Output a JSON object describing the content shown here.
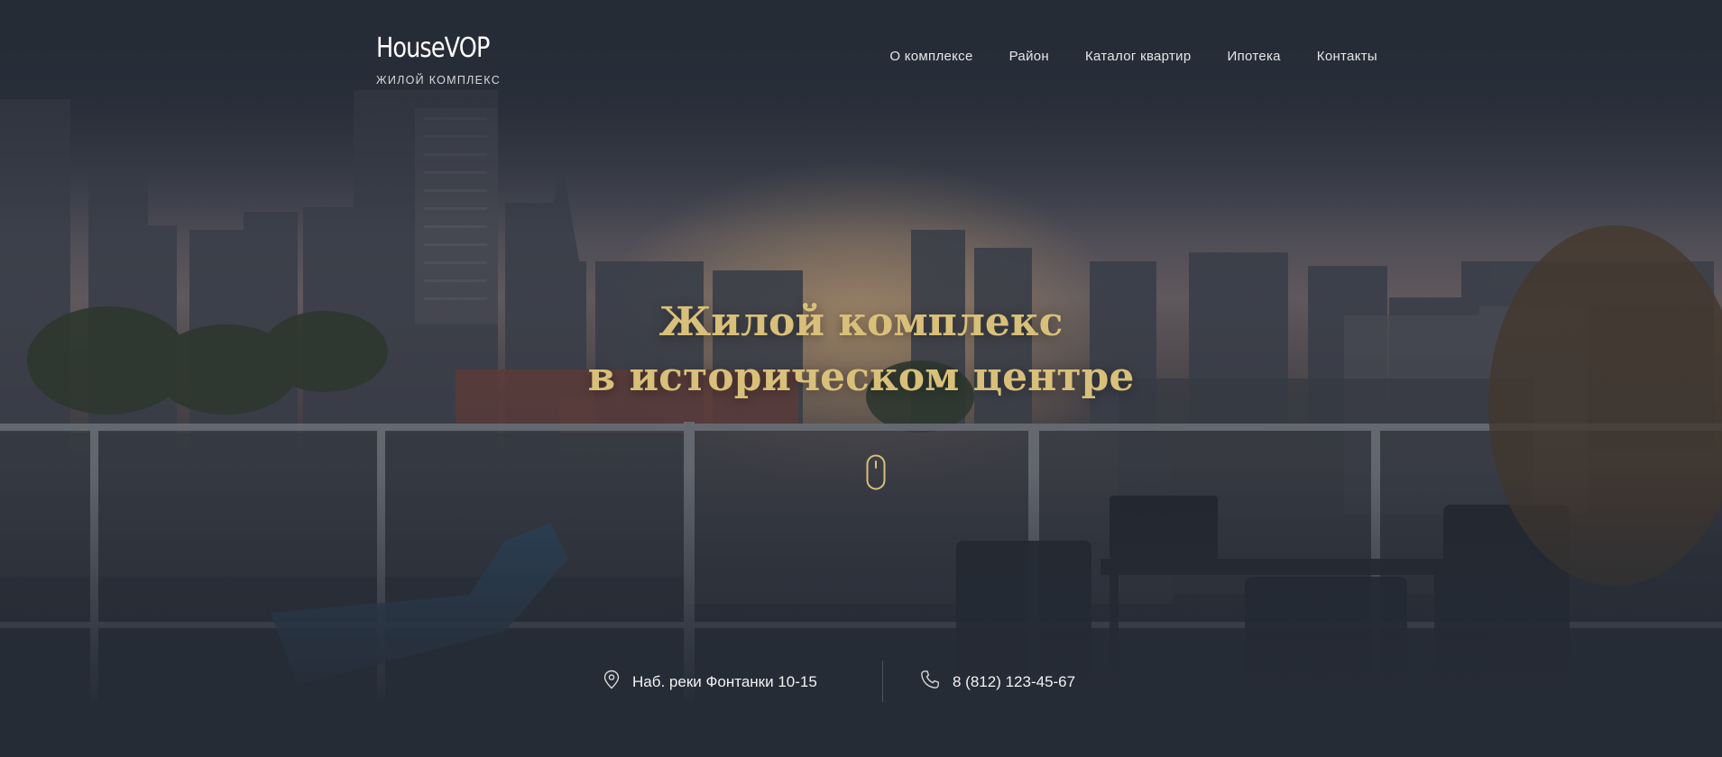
{
  "brand": {
    "name": "HouseVOP",
    "tagline": "ЖИЛОЙ КОМПЛЕКС"
  },
  "nav": {
    "items": [
      {
        "label": "О комплексе"
      },
      {
        "label": "Район"
      },
      {
        "label": "Каталог квартир"
      },
      {
        "label": "Ипотека"
      },
      {
        "label": "Контакты"
      }
    ]
  },
  "hero": {
    "title_line1": "Жилой комплекс",
    "title_line2": "в историческом центре",
    "scroll_icon": "mouse-icon"
  },
  "contacts": {
    "address": "Наб. реки Фонтанки 10-15",
    "address_icon": "location-pin-icon",
    "phone": "8 (812) 123-45-67",
    "phone_icon": "phone-icon"
  },
  "colors": {
    "background": "#262c36",
    "accent": "#d9c07a",
    "text": "#ffffff"
  }
}
